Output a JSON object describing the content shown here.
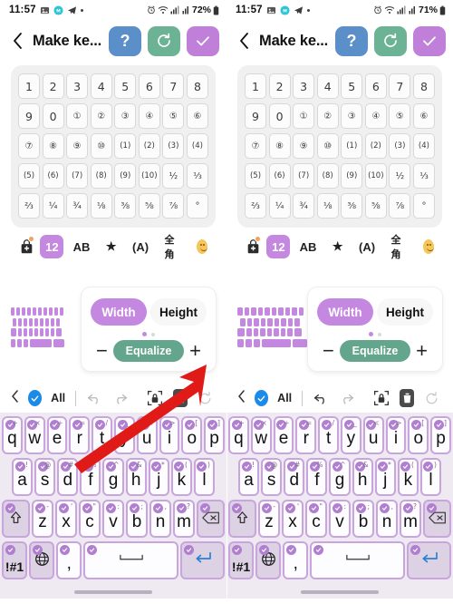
{
  "status_bar": {
    "time": "11:57",
    "left_icons": [
      "gallery-icon",
      "messenger-icon",
      "telegram-icon",
      "dot-icon"
    ],
    "right_icons": [
      "alarm-icon",
      "wifi-call-icon",
      "signal-icon",
      "signal2-icon"
    ],
    "battery_left": "72%",
    "battery_right": "71%"
  },
  "header": {
    "back_icon": "back-chevron-icon",
    "title": "Make ke...",
    "help_label": "?",
    "reset_icon": "reset-icon",
    "done_icon": "check-icon"
  },
  "char_grid": {
    "rows": [
      [
        "1",
        "2",
        "3",
        "4",
        "5",
        "6",
        "7",
        "8"
      ],
      [
        "9",
        "0",
        "①",
        "②",
        "③",
        "④",
        "⑤",
        "⑥"
      ],
      [
        "⑦",
        "⑧",
        "⑨",
        "⑩",
        "(1)",
        "(2)",
        "(3)",
        "(4)"
      ],
      [
        "(5)",
        "(6)",
        "(7)",
        "(8)",
        "(9)",
        "(10)",
        "½",
        "⅓"
      ],
      [
        "⅔",
        "¼",
        "¾",
        "⅛",
        "⅜",
        "⅝",
        "⅞",
        "°"
      ]
    ]
  },
  "category_bar": {
    "items": [
      {
        "name": "store-icon",
        "label": ""
      },
      {
        "name": "category-numbers",
        "label": "12"
      },
      {
        "name": "category-latin",
        "label": "AB"
      },
      {
        "name": "category-favorites",
        "label": "★"
      },
      {
        "name": "category-enclosed",
        "label": "(A)"
      },
      {
        "name": "category-fullwidth",
        "label": "全角"
      },
      {
        "name": "category-emoji",
        "label": ""
      }
    ],
    "active_index": 1
  },
  "resize_panel": {
    "preview_icon": "keyboard-preview-icon",
    "width_label": "Width",
    "height_label": "Height",
    "equalize_label": "Equalize",
    "minus_label": "−",
    "plus_label": "+",
    "page_dots": 2,
    "active_dot": 0
  },
  "edit_toolbar": {
    "back_icon": "chevron-left-icon",
    "select_all_icon": "select-all-check-icon",
    "all_label": "All",
    "undo_icon": "undo-icon",
    "redo_icon": "redo-icon",
    "lock_icon": "lock-key-icon",
    "delete_icon": "trash-icon",
    "refresh_icon": "refresh-icon"
  },
  "keyboard": {
    "rows": [
      [
        {
          "key": "q",
          "alt": "+"
        },
        {
          "key": "w",
          "alt": "×"
        },
        {
          "key": "e",
          "alt": "÷"
        },
        {
          "key": "r",
          "alt": "="
        },
        {
          "key": "t",
          "alt": "/"
        },
        {
          "key": "y",
          "alt": "_"
        },
        {
          "key": "u",
          "alt": "<"
        },
        {
          "key": "i",
          "alt": ">"
        },
        {
          "key": "o",
          "alt": "["
        },
        {
          "key": "p",
          "alt": "]"
        }
      ],
      [
        {
          "key": "a",
          "alt": "!"
        },
        {
          "key": "s",
          "alt": "@"
        },
        {
          "key": "d",
          "alt": "#"
        },
        {
          "key": "f",
          "alt": "%"
        },
        {
          "key": "g",
          "alt": "^"
        },
        {
          "key": "h",
          "alt": "&"
        },
        {
          "key": "j",
          "alt": "*"
        },
        {
          "key": "k",
          "alt": "("
        },
        {
          "key": "l",
          "alt": ")"
        }
      ],
      [
        {
          "key": "⇧",
          "alt": "",
          "name": "shift-key"
        },
        {
          "key": "z",
          "alt": "-"
        },
        {
          "key": "x",
          "alt": "'"
        },
        {
          "key": "c",
          "alt": "\""
        },
        {
          "key": "v",
          "alt": ":"
        },
        {
          "key": "b",
          "alt": ";"
        },
        {
          "key": "n",
          "alt": ","
        },
        {
          "key": "m",
          "alt": "?"
        },
        {
          "key": "⌫",
          "alt": "",
          "name": "backspace-key"
        }
      ],
      [
        {
          "key": "!#1",
          "alt": "",
          "name": "symbols-key"
        },
        {
          "key": "🌐",
          "alt": "",
          "name": "language-key"
        },
        {
          "key": ",",
          "alt": "",
          "name": "comma-key"
        },
        {
          "key": "␣",
          "alt": "",
          "name": "space-key"
        },
        {
          "key": "↵",
          "alt": "",
          "name": "enter-key"
        }
      ]
    ]
  },
  "annotation": {
    "arrow_color": "#e01b17",
    "points_to": "plus-button"
  },
  "colors": {
    "accent_purple": "#c588e0",
    "key_border": "#c9a5dd",
    "equalize_green": "#63a58d",
    "help_blue": "#5b8fc9",
    "reset_green": "#6bb394",
    "keyboard_bg": "#efeaf2"
  }
}
